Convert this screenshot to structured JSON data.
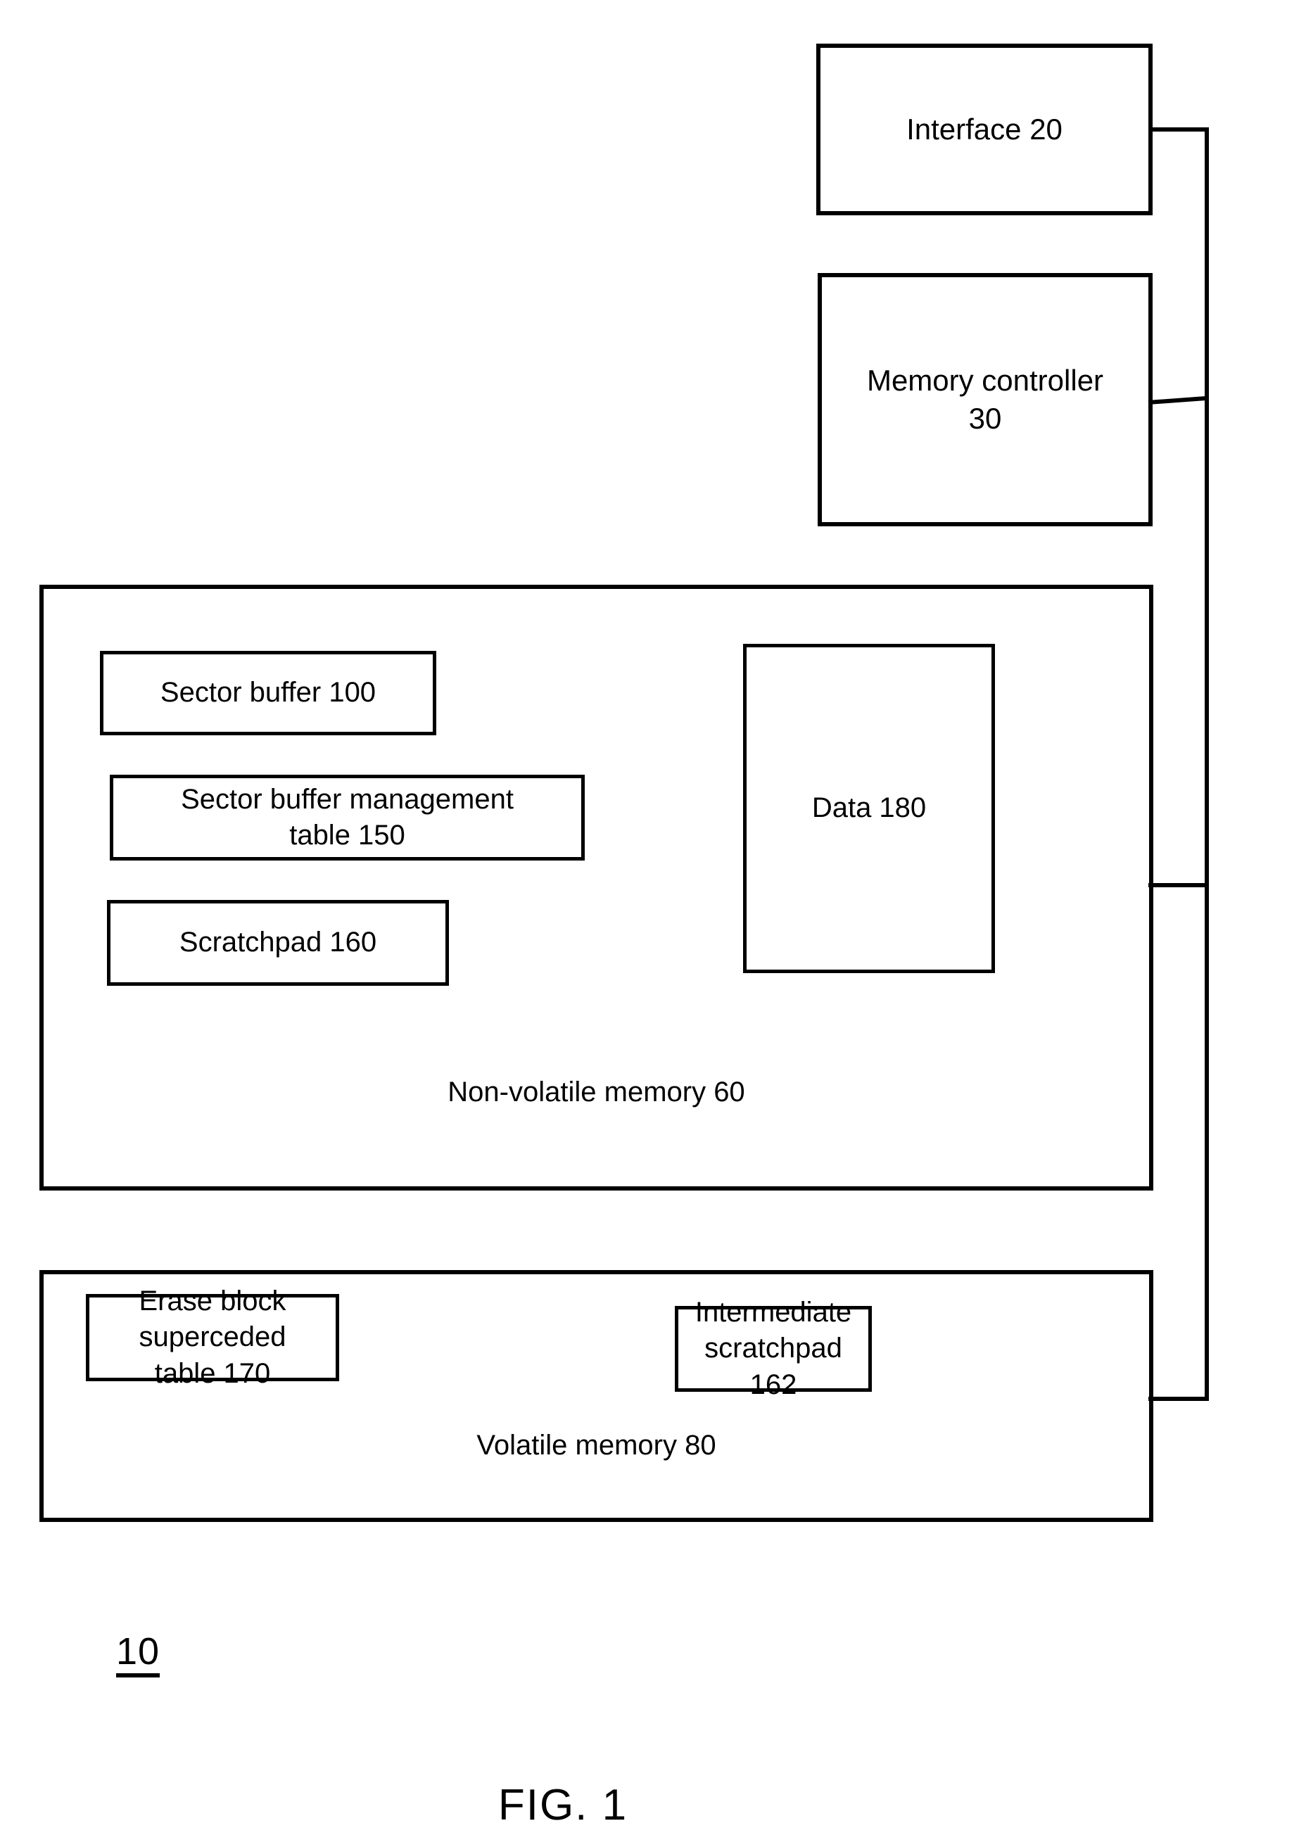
{
  "figure": {
    "caption": "FIG. 1",
    "system_reference": "10"
  },
  "blocks": {
    "interface": {
      "label": "Interface 20"
    },
    "memory_controller": {
      "label": "Memory controller\n30"
    },
    "non_volatile_memory": {
      "label": "Non-volatile memory 60",
      "children": {
        "sector_buffer": {
          "label": "Sector buffer 100"
        },
        "sector_buffer_management_table": {
          "label": "Sector buffer management\ntable 150"
        },
        "scratchpad": {
          "label": "Scratchpad 160"
        },
        "data": {
          "label": "Data 180"
        }
      }
    },
    "volatile_memory": {
      "label": "Volatile memory 80",
      "children": {
        "erase_block_superceded_table": {
          "label": "Erase block superceded\ntable 170"
        },
        "intermediate_scratchpad": {
          "label": "Intermediate\nscratchpad 162"
        }
      }
    }
  },
  "colors": {
    "stroke": "#000000",
    "background": "#ffffff"
  }
}
